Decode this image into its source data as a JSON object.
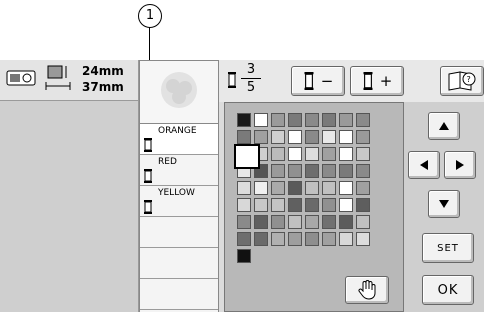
{
  "callout": {
    "number": "1"
  },
  "size": {
    "height": "24mm",
    "width": "37mm"
  },
  "colors": [
    {
      "name": "ORANGE",
      "spool": "#ffffff",
      "selected": true
    },
    {
      "name": "RED",
      "spool": "#ffffff",
      "selected": false
    },
    {
      "name": "YELLOW",
      "spool": "#ffffff",
      "selected": false
    },
    {
      "name": "",
      "spool": "",
      "selected": false
    },
    {
      "name": "",
      "spool": "",
      "selected": false
    },
    {
      "name": "",
      "spool": "",
      "selected": false
    }
  ],
  "counter": {
    "current": "3",
    "total": "5"
  },
  "buttons": {
    "minus": "−",
    "plus": "+",
    "set": "SET",
    "ok": "OK"
  },
  "palette": [
    [
      "#1a1a1a",
      "#ffffff",
      "#9a9a9a",
      "#7a7a7a",
      "#8a8a8a",
      "#7a7a7a",
      "#9a9a9a",
      "#8a8a8a"
    ],
    [
      "#7a7a7a",
      "#a0a0a0",
      "#d0d0d0",
      "#ffffff",
      "#8a8a8a",
      "#e8e8e8",
      "#ffffff",
      "#9a9a9a"
    ],
    [
      "#e6e6e6",
      "#cfcfcf",
      "#bbbbbb",
      "#ffffff",
      "#dddddd",
      "#a0a0a0",
      "#ffffff",
      "#c8c8c8"
    ],
    [
      "#e8e8e8",
      "#555555",
      "#9a9a9a",
      "#909090",
      "#6e6e6e",
      "#8a8a8a",
      "#7a7a7a",
      "#8a8a8a"
    ],
    [
      "#dcdcdc",
      "#f0f0f0",
      "#aaaaaa",
      "#5a5a5a",
      "#c0c0c0",
      "#c0c0c0",
      "#ffffff",
      "#a0a0a0"
    ],
    [
      "#d8d8d8",
      "#c8c8c8",
      "#c4c4c4",
      "#606060",
      "#6a6a6a",
      "#909090",
      "#ffffff",
      "#5e5e5e"
    ],
    [
      "#8a8a8a",
      "#606060",
      "#909090",
      "#c0c0c0",
      "#a8a8a8",
      "#707070",
      "#5c5c5c",
      "#c0c0c0"
    ],
    [
      "#6e6e6e",
      "#6a6a6a",
      "#b0b0b0",
      "#9e9e9e",
      "#8e8e8e",
      "#a0a0a0",
      "#d8d8d8",
      "#dcdcdc"
    ],
    [
      "#111111",
      "",
      "",
      "",
      "",
      "",
      "",
      ""
    ]
  ],
  "icons": {
    "machine": "embroidery-machine-icon",
    "size": "size-icon",
    "spool": "thread-spool-icon",
    "help": "help-book-icon",
    "hand": "hand-icon",
    "up": "up-arrow-icon",
    "down": "down-arrow-icon",
    "left": "left-arrow-icon",
    "right": "right-arrow-icon"
  }
}
